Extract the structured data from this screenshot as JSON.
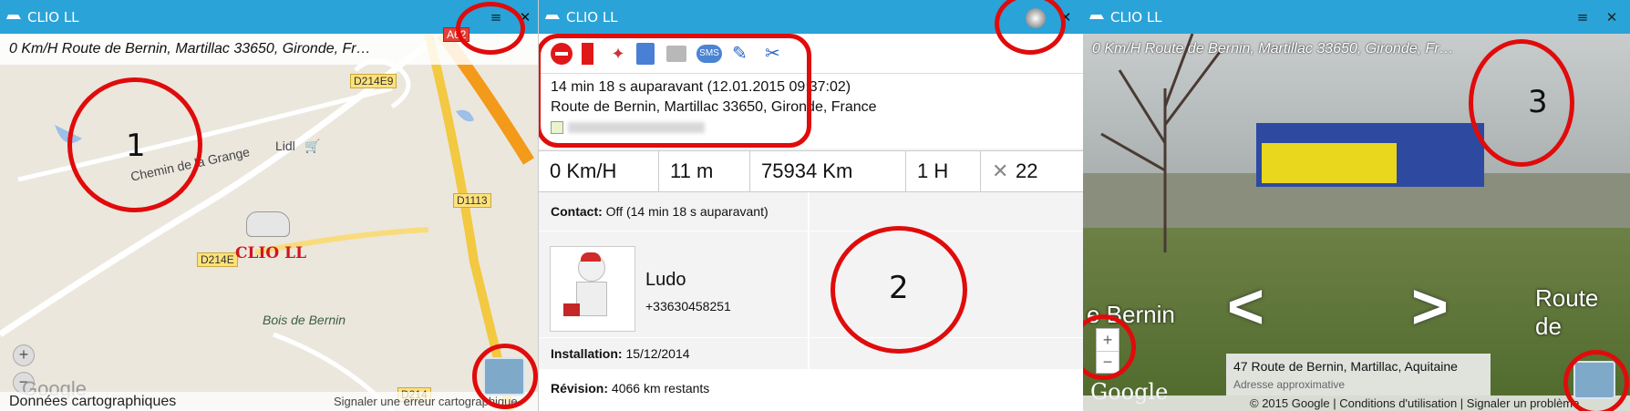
{
  "panel1": {
    "title": "CLIO LL",
    "address": "0 Km/H   Route de Bernin, Martillac 33650, Gironde, Fr…",
    "map_labels": {
      "chemin": "Chemin de la Grange",
      "lidl": "Lidl",
      "bois": "Bois de Bernin",
      "vehicle": "CLIO LL",
      "google": "Google"
    },
    "roads": [
      "D214E9",
      "D1113",
      "D214E",
      "D214",
      "A62"
    ],
    "footer_left": "Données cartographiques",
    "footer_right": "Signaler une erreur cartographique",
    "marker_number": "1"
  },
  "panel2": {
    "title": "CLIO LL",
    "time_ago": "14 min 18 s auparavant (12.01.2015 09:37:02)",
    "address": "Route de Bernin, Martillac 33650, Gironde, France",
    "stats": [
      "0 Km/H",
      "11 m",
      "75934 Km",
      "1 H",
      "22"
    ],
    "contact_label": "Contact:",
    "contact_value": " Off (14 min 18 s auparavant)",
    "driver_name": "Ludo",
    "driver_phone": "+33630458251",
    "installation_label": "Installation:",
    "installation_value": " 15/12/2014",
    "revision_label": "Révision:",
    "revision_value": " 4066 km restants",
    "marker_number": "2",
    "sms": "SMS"
  },
  "panel3": {
    "title": "CLIO LL",
    "address": "0 Km/H   Route de Bernin, Martillac 33650, Gironde, Fr…",
    "street_left": "e Bernin",
    "street_right": "Route de",
    "info_title": "47 Route de Bernin, Martillac, Aquitaine",
    "info_sub": "Adresse approximative",
    "google": "Google",
    "footer": "© 2015 Google  |  Conditions d'utilisation  |  Signaler un problème",
    "marker_number": "3"
  },
  "colors": {
    "titlebar": "#2aa3d8",
    "marker": "#e00b0b",
    "vehicle_label": "#d0161a"
  }
}
